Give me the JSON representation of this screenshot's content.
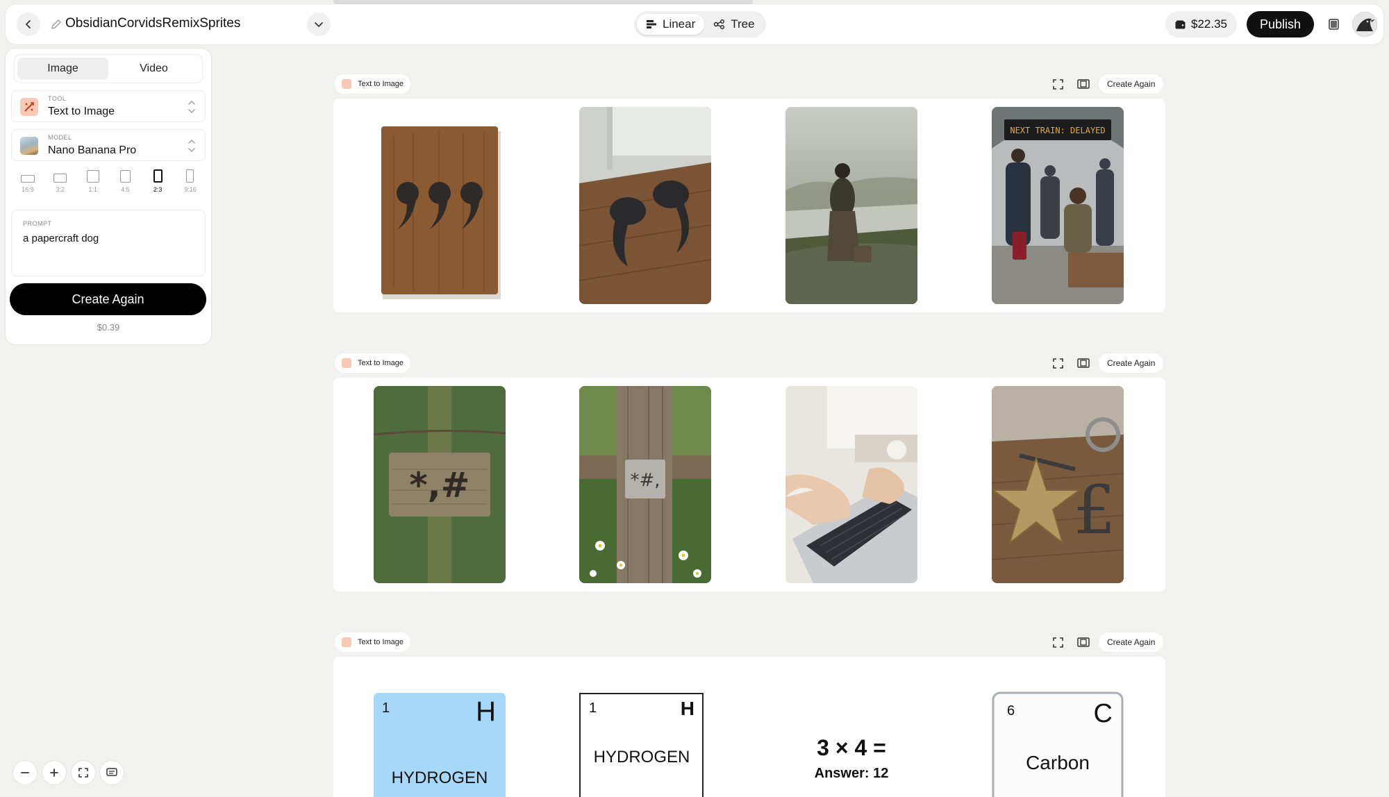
{
  "topbar": {
    "title": "ObsidianCorvidsRemixSprites",
    "view_options": [
      "Linear",
      "Tree"
    ],
    "active_view": "Linear",
    "credits": "$22.35",
    "publish_label": "Publish"
  },
  "panel": {
    "tabs": [
      "Image",
      "Video"
    ],
    "active_tab": "Image",
    "tool_caption": "TOOL",
    "tool_value": "Text to Image",
    "model_caption": "MODEL",
    "model_value": "Nano Banana Pro",
    "ratios": [
      "16:9",
      "3:2",
      "1:1",
      "4:5",
      "2:3",
      "9:16"
    ],
    "active_ratio": "2:3",
    "prompt_caption": "PROMPT",
    "prompt_value": "a papercraft dog",
    "create_label": "Create Again",
    "cost": "$0.39"
  },
  "generations": [
    {
      "tool": "Text to Image",
      "create_again": "Create Again",
      "images": [
        {
          "desc": "wooden board with three carved comma marks"
        },
        {
          "desc": "metal comma shapes on wooden table"
        },
        {
          "desc": "man sitting on stone wall by misty river"
        },
        {
          "desc": "train station platform",
          "sign": "NEXT TRAIN: DELAYED"
        }
      ]
    },
    {
      "tool": "Text to Image",
      "create_again": "Create Again",
      "images": [
        {
          "desc": "wooden sign on mossy post",
          "sign": "*,#"
        },
        {
          "desc": "metal plaque on fence post among daisies",
          "sign": "*#,"
        },
        {
          "desc": "hands typing on laptop"
        },
        {
          "desc": "metal star and pound sign on workbench"
        }
      ]
    },
    {
      "tool": "Text to Image",
      "create_again": "Create Again",
      "images": [
        {
          "number": "1",
          "symbol": "H",
          "name": "HYDROGEN"
        },
        {
          "number": "1",
          "symbol": "H",
          "name": "HYDROGEN"
        },
        {
          "equation": "3 × 4 =",
          "answer": "Answer: 12"
        },
        {
          "number": "6",
          "symbol": "C",
          "name": "Carbon"
        }
      ]
    }
  ],
  "colors": {
    "accent": "#111111",
    "tool_icon": "#f8c9b5",
    "hydrogen_tile": "#a7d8f8"
  }
}
